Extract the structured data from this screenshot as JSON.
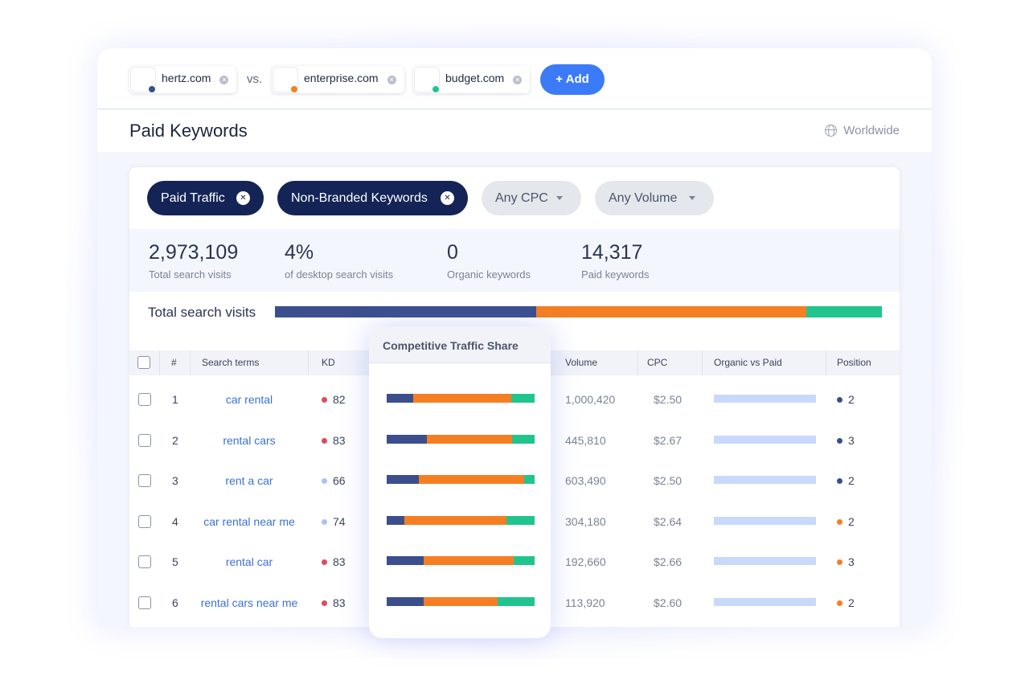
{
  "colors": {
    "hertz": "#3b4f8d",
    "enterprise": "#f67e22",
    "budget": "#22c48d",
    "accent": "#3b7bf7",
    "navy": "#142456"
  },
  "competitors": [
    {
      "name": "hertz.com",
      "dot_color": "#3b4f8d"
    },
    {
      "name": "enterprise.com",
      "dot_color": "#f67e22"
    },
    {
      "name": "budget.com",
      "dot_color": "#22c48d"
    }
  ],
  "vs_label": "vs.",
  "add_button_label": "+ Add",
  "page_title": "Paid Keywords",
  "region": "Worldwide",
  "filters": [
    {
      "label": "Paid Traffic",
      "active": true
    },
    {
      "label": "Non-Branded Keywords",
      "active": true
    },
    {
      "label": "Any CPC",
      "active": false
    },
    {
      "label": "Any Volume",
      "active": false
    }
  ],
  "stats": [
    {
      "value": "2,973,109",
      "label": "Total search visits"
    },
    {
      "value": "4%",
      "label": "of desktop search visits"
    },
    {
      "value": "0",
      "label": "Organic keywords"
    },
    {
      "value": "14,317",
      "label": "Paid keywords"
    }
  ],
  "total_search_visits": {
    "label": "Total search visits",
    "shares": [
      0.43,
      0.445,
      0.125
    ]
  },
  "table": {
    "columns": [
      "#",
      "Search terms",
      "KD",
      "Volume",
      "CPC",
      "Organic vs Paid",
      "Position"
    ],
    "rows": [
      {
        "n": "1",
        "term": "car rental",
        "kd": "82",
        "kd_color": "#dc4b5c",
        "volume": "1,000,420",
        "cpc": "$2.50",
        "organic_vs_paid": 1.0,
        "position": "2",
        "pos_color": "#3b4f8d"
      },
      {
        "n": "2",
        "term": "rental cars",
        "kd": "83",
        "kd_color": "#dc4b5c",
        "volume": "445,810",
        "cpc": "$2.67",
        "organic_vs_paid": 1.0,
        "position": "3",
        "pos_color": "#3b4f8d"
      },
      {
        "n": "3",
        "term": "rent a car",
        "kd": "66",
        "kd_color": "#a9c3f6",
        "volume": "603,490",
        "cpc": "$2.50",
        "organic_vs_paid": 1.0,
        "position": "2",
        "pos_color": "#3b4f8d"
      },
      {
        "n": "4",
        "term": "car rental near me",
        "kd": "74",
        "kd_color": "#a9c3f6",
        "volume": "304,180",
        "cpc": "$2.64",
        "organic_vs_paid": 1.0,
        "position": "2",
        "pos_color": "#f67e22"
      },
      {
        "n": "5",
        "term": "rental car",
        "kd": "83",
        "kd_color": "#dc4b5c",
        "volume": "192,660",
        "cpc": "$2.66",
        "organic_vs_paid": 1.0,
        "position": "3",
        "pos_color": "#f67e22"
      },
      {
        "n": "6",
        "term": "rental cars near me",
        "kd": "83",
        "kd_color": "#dc4b5c",
        "volume": "113,920",
        "cpc": "$2.60",
        "organic_vs_paid": 1.0,
        "position": "2",
        "pos_color": "#f67e22"
      }
    ]
  },
  "competitive_traffic_share": {
    "title": "Competitive Traffic Share",
    "rows": [
      [
        0.18,
        0.66,
        0.16
      ],
      [
        0.27,
        0.58,
        0.15
      ],
      [
        0.22,
        0.71,
        0.07
      ],
      [
        0.12,
        0.69,
        0.19
      ],
      [
        0.25,
        0.61,
        0.14
      ],
      [
        0.25,
        0.5,
        0.25
      ]
    ]
  }
}
